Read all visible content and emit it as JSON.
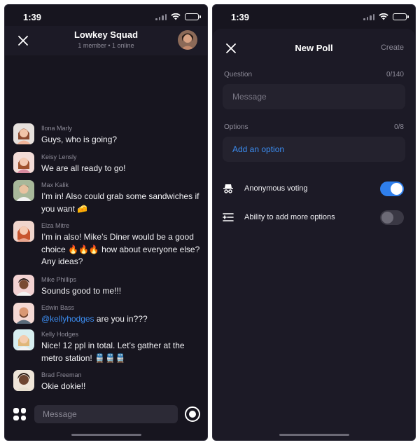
{
  "chat_screen": {
    "status_time": "1:39",
    "header": {
      "title": "Lowkey Squad",
      "subtitle": "1 member • 1 online"
    },
    "messages": [
      {
        "author": "Ilona  Marly",
        "text": "Guys, who is going?"
      },
      {
        "author": "Keisy Lensly",
        "text": "We are all ready to go!"
      },
      {
        "author": "Max Kalik",
        "text": "I’m in! Also could grab some sandwiches if you want 🧀"
      },
      {
        "author": "Elza Mitre",
        "text": "I’m in also! Mike’s Diner would be a good choice 🔥🔥🔥 how about everyone else? Any ideas?"
      },
      {
        "author": "Mike Phillips",
        "text": "Sounds good to me!!!"
      },
      {
        "author": "Edwin Bass",
        "mention": "@kellyhodges",
        "text": " are you in???"
      },
      {
        "author": "Kelly Hodges",
        "text": "Nice! 12 ppl in total. Let’s gather at the metro station! 🚆🚆🚆"
      },
      {
        "author": "Brad Freeman",
        "text": "Okie dokie!!"
      }
    ],
    "composer": {
      "placeholder": "Message"
    }
  },
  "poll_screen": {
    "status_time": "1:39",
    "title": "New Poll",
    "create_label": "Create",
    "question": {
      "label": "Question",
      "count": "0/140",
      "placeholder": "Message"
    },
    "options": {
      "label": "Options",
      "count": "0/8",
      "add_label": "Add an option"
    },
    "settings": [
      {
        "label": "Anonymous voting",
        "enabled": true,
        "icon": "anonymous-icon"
      },
      {
        "label": "Ability to add more options",
        "enabled": false,
        "icon": "add-list-icon"
      }
    ]
  },
  "colors": {
    "background": "#17151f",
    "surface": "#1c1a26",
    "accent": "#2f7fec",
    "link": "#3b8cf0",
    "muted_text": "#8e8c99"
  }
}
